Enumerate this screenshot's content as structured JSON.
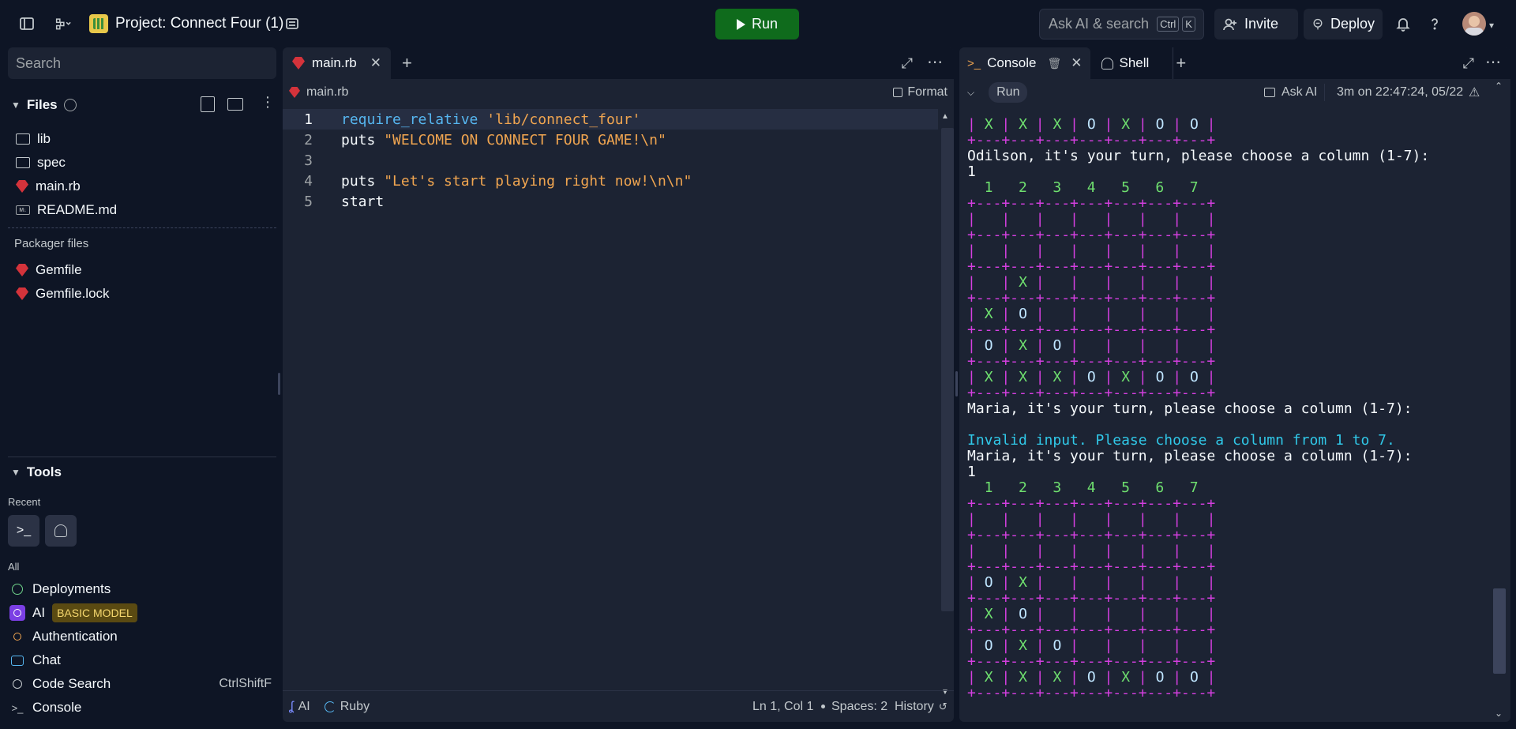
{
  "header": {
    "project_title": "Project: Connect Four (1)",
    "run_label": "Run",
    "ask_placeholder": "Ask AI & search",
    "kbd_ctrl": "Ctrl",
    "kbd_k": "K",
    "invite_label": "Invite",
    "deploy_label": "Deploy"
  },
  "sidebar": {
    "search_placeholder": "Search",
    "files_title": "Files",
    "files": [
      {
        "name": "lib",
        "icon": "folder-icon"
      },
      {
        "name": "spec",
        "icon": "folder-icon"
      },
      {
        "name": "main.rb",
        "icon": "ruby-icon"
      },
      {
        "name": "README.md",
        "icon": "markdown-icon"
      }
    ],
    "packager_label": "Packager files",
    "packager_files": [
      {
        "name": "Gemfile",
        "icon": "ruby-icon"
      },
      {
        "name": "Gemfile.lock",
        "icon": "ruby-icon"
      }
    ],
    "tools_title": "Tools",
    "recent_label": "Recent",
    "all_label": "All",
    "tools": [
      {
        "name": "Deployments",
        "icon": "deployments-icon"
      },
      {
        "name": "AI",
        "icon": "ai-icon",
        "badge": "BASIC MODEL"
      },
      {
        "name": "Authentication",
        "icon": "user-icon"
      },
      {
        "name": "Chat",
        "icon": "chat-icon"
      },
      {
        "name": "Code Search",
        "icon": "search-icon",
        "shortcut": "CtrlShiftF"
      },
      {
        "name": "Console",
        "icon": "terminal-icon"
      }
    ]
  },
  "editor": {
    "tab_label": "main.rb",
    "breadcrumb": "main.rb",
    "format_label": "Format",
    "lines": [
      {
        "n": "1",
        "tokens": [
          {
            "t": "require_relative",
            "c": "fn"
          },
          {
            "t": " ",
            "c": "plain"
          },
          {
            "t": "'lib/connect_four'",
            "c": "str"
          }
        ]
      },
      {
        "n": "2",
        "tokens": [
          {
            "t": "puts ",
            "c": "plain"
          },
          {
            "t": "\"WELCOME ON CONNECT FOUR GAME!\\n\"",
            "c": "str"
          }
        ]
      },
      {
        "n": "3",
        "tokens": []
      },
      {
        "n": "4",
        "tokens": [
          {
            "t": "puts ",
            "c": "plain"
          },
          {
            "t": "\"Let's start playing right now!\\n\\n\"",
            "c": "str"
          }
        ]
      },
      {
        "n": "5",
        "tokens": [
          {
            "t": "start",
            "c": "plain"
          }
        ]
      }
    ],
    "status": {
      "ai": "AI",
      "language": "Ruby",
      "cursor": "Ln 1, Col 1",
      "spaces": "Spaces: 2",
      "history": "History"
    }
  },
  "console": {
    "tab_console": "Console",
    "tab_shell": "Shell",
    "run_label": "Run",
    "ask_ai_label": "Ask AI",
    "run_info": "3m on 22:47:24, 05/22",
    "lines": [
      {
        "t": "| X | X | X | O | X | O | O |",
        "c": "board"
      },
      {
        "t": "+---+---+---+---+---+---+---+",
        "c": "mag"
      },
      {
        "t": "Odilson, it's your turn, please choose a column (1-7):",
        "c": "white"
      },
      {
        "t": "1",
        "c": "white"
      },
      {
        "t": "  1   2   3   4   5   6   7",
        "c": "green"
      },
      {
        "t": "+---+---+---+---+---+---+---+",
        "c": "mag"
      },
      {
        "t": "|   |   |   |   |   |   |   |",
        "c": "board"
      },
      {
        "t": "+---+---+---+---+---+---+---+",
        "c": "mag"
      },
      {
        "t": "|   |   |   |   |   |   |   |",
        "c": "board"
      },
      {
        "t": "+---+---+---+---+---+---+---+",
        "c": "mag"
      },
      {
        "t": "|   | X |   |   |   |   |   |",
        "c": "board"
      },
      {
        "t": "+---+---+---+---+---+---+---+",
        "c": "mag"
      },
      {
        "t": "| X | O |   |   |   |   |   |",
        "c": "board"
      },
      {
        "t": "+---+---+---+---+---+---+---+",
        "c": "mag"
      },
      {
        "t": "| O | X | O |   |   |   |   |",
        "c": "board"
      },
      {
        "t": "+---+---+---+---+---+---+---+",
        "c": "mag"
      },
      {
        "t": "| X | X | X | O | X | O | O |",
        "c": "board"
      },
      {
        "t": "+---+---+---+---+---+---+---+",
        "c": "mag"
      },
      {
        "t": "Maria, it's your turn, please choose a column (1-7):",
        "c": "white"
      },
      {
        "t": "",
        "c": "white"
      },
      {
        "t": "Invalid input. Please choose a column from 1 to 7.",
        "c": "cyan"
      },
      {
        "t": "Maria, it's your turn, please choose a column (1-7):",
        "c": "white"
      },
      {
        "t": "1",
        "c": "white"
      },
      {
        "t": "  1   2   3   4   5   6   7",
        "c": "green"
      },
      {
        "t": "+---+---+---+---+---+---+---+",
        "c": "mag"
      },
      {
        "t": "|   |   |   |   |   |   |   |",
        "c": "board"
      },
      {
        "t": "+---+---+---+---+---+---+---+",
        "c": "mag"
      },
      {
        "t": "|   |   |   |   |   |   |   |",
        "c": "board"
      },
      {
        "t": "+---+---+---+---+---+---+---+",
        "c": "mag"
      },
      {
        "t": "| O | X |   |   |   |   |   |",
        "c": "board"
      },
      {
        "t": "+---+---+---+---+---+---+---+",
        "c": "mag"
      },
      {
        "t": "| X | O |   |   |   |   |   |",
        "c": "board"
      },
      {
        "t": "+---+---+---+---+---+---+---+",
        "c": "mag"
      },
      {
        "t": "| O | X | O |   |   |   |   |",
        "c": "board"
      },
      {
        "t": "+---+---+---+---+---+---+---+",
        "c": "mag"
      },
      {
        "t": "| X | X | X | O | X | O | O |",
        "c": "board"
      },
      {
        "t": "+---+---+---+---+---+---+---+",
        "c": "mag"
      }
    ]
  },
  "colors": {
    "background": "#0e1525",
    "panel": "#1c2333",
    "run_green": "#0f6b1c",
    "board_magenta": "#d53fe0",
    "piece_x": "#6fe06f",
    "piece_o": "#bfe5ff",
    "error_cyan": "#30c8e8",
    "string": "#f0a550",
    "keyword": "#56b6f0"
  }
}
